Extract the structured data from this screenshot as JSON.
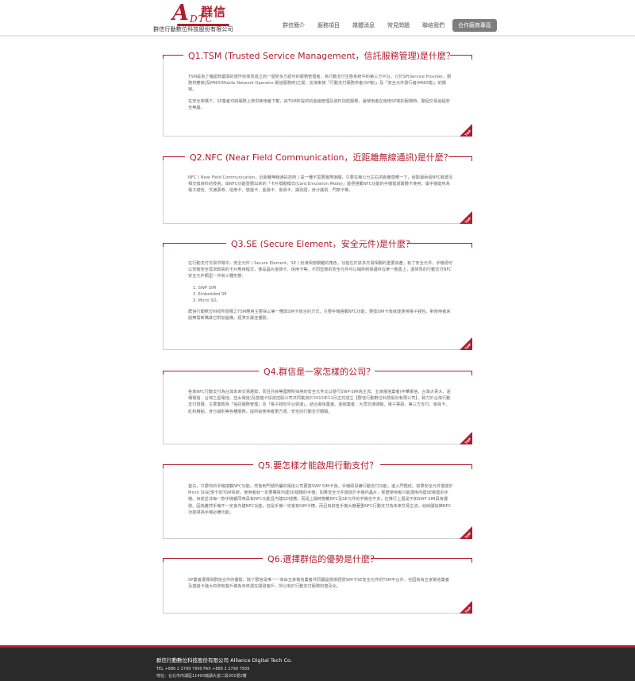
{
  "header": {
    "logo_letter": "A",
    "logo_sub": "DTC",
    "logo_zh": "群信",
    "company_name": "群信行動數位科技股份有限公司",
    "nav": [
      {
        "label": "群信簡介"
      },
      {
        "label": "服務項目"
      },
      {
        "label": "媒體消息"
      },
      {
        "label": "常見問題"
      },
      {
        "label": "聯絡我們"
      },
      {
        "label": "合作廠商專區"
      }
    ]
  },
  "faqs": [
    {
      "question": "Q1.TSM (Trusted Service Management，信託服務管理)是什麼？",
      "paragraphs": [
        "TSM是為了確認商業間的運作效率而成立的一個受多方認可的服務管理者，為行動支付生態系統中的第三方平台，介於SP(Service Provider，服務供應商)及MNO(Mobile Network Operator,電信服務商)之間，扮演串接「行動支付服務供者(SP端)」及「安全元件發行者(MNO端)」的橋樑。",
        "在安全架構下，SP業者可將服務上架供使用者下載，由TSM所提供的金鑰管理及資料加密服務，讓使用者在使用SP端的服務時，整個交易過程安全無虞。"
      ],
      "list": [],
      "top_label": "TOP"
    },
    {
      "question": "Q2.NFC (Near Field Communication，近距離無線通訊)是什麼？",
      "paragraphs": [
        "NFC ( Near Field Communication，近距離無線通訊技術 ) 是一種不需要實際接觸，只要在幾公分左右的距離感應一下，就能讓兩個NFC裝置互相交換資料的技術。由NFC功能發展出來的「卡片模擬模式(Card Emulation Mode)」能把搭載NFC功能的手機當成實體卡使用，讓手機變身為電子錢包、交通票券、信用卡、悠遊卡、金融卡、會員卡、識別證、身分識別、門禁卡等。"
      ],
      "list": [],
      "top_label": "TOP"
    },
    {
      "question": "Q3.SE (Secure Element，安全元件)是什麼？",
      "paragraphs": [
        "在行動支付交易市場中，安全元件 ( Secure Element，SE ) 扮演相當關鍵的角色，功能在於許多交易相關的重要資產，有了安全元件，手機便可以安裝安全需求較高的卡片應用程式，像是晶片金融卡、信用卡等。不同型態的安全元件可以儲存和保護存在單一裝置上，還常見的行動支付NFC安全元件類型一共有三種形態："
      ],
      "list": [
        "1. SWP SIM",
        "2. Embedded SE",
        "3. Micro SD。"
      ],
      "paragraphs_after": [
        "群信行動數位科技所發展之TSM應用主要採以第一種與SIM卡結合的方式，只要手機搭載NFC功能，更換SIM卡後就能使用電子錢包，對使用者來說無需新購其它附加設備，經濟又最佳優勢。"
      ],
      "top_label": "TOP"
    },
    {
      "question": "Q4.群信是一家怎樣的公司？",
      "paragraphs": [
        "各家NFC行動支付為台灣未來交易趨勢，而且外資等國際所採用的安全元件又以發行SWP-SIM為主流，五家電信業者(中華電信、台灣大哥大、遠傳電信、台灣之星電信、亞太電信)及悠遊卡投資控股公司共同集資於2013年11月正式成立【群信行動數位科技股份有限公司】，致力於台灣行動支付發展，主要業務為「信託服務管理」及「電子錢包平台營運」，結合電信業者、金融業者、大眾交通運輸、電子票證、第三方支付、會員卡、紅利積點、身分識別等各種服務，提供給使用者更方便、安全的行動支付體驗。"
      ],
      "list": [],
      "top_label": "TOP"
    },
    {
      "question": "Q5.要怎樣才能啟用行動支付？",
      "paragraphs": [
        "首先，只要你的手機搭載NFC功能，然後到門號所屬的電信公司更換SWP SIM卡後，手機即具備行動支付功能，進入門檻低。如果安全元件擺放於Micro SD記憶卡的TSM系統，使用者就一定要購買內建SD插槽的手機；如果安全元件擺放於手機內晶片，那麼使用者只能選用內建SE裝置的手機。目前並非每一款手機都同時具有NFC功能且內建SD插槽，而是上開時搭載NFC及SE元件的手機也不多，在推行上還是不如SWP SIM具有優勢。因為雖然手機不一定會內建NFC功能，但是手機一定會有SIM卡槽，而且目前各手機大廠著重NFC行動支付為未來交易主流，紛紛開始推NFC功能視為手機必備功能。"
      ],
      "list": [],
      "top_label": "TOP"
    },
    {
      "question": "Q6.選擇群信的優勢是什麼？",
      "paragraphs": [
        "SP業者選擇與群信合作的優勢，除了群信是唯一一家由五家電信業者共同籌設營運經營SIM卡SE安全元件的TSM平台外，也因為有五家電信業者及悠遊卡強大的既有客戶做為未來潛在開發客戶，所以有於行動支付服務的普及化。"
      ],
      "list": [],
      "top_label": "TOP"
    }
  ],
  "footer": {
    "company": "群信行動數位科技股份有限公司 Alliance Digital Tech Co.",
    "tel": "TEL +886 2 2799 7900  FAX +886 2 2799 7939",
    "address": "地址：台北市內湖區11493瑞湖大道二段301號2樓"
  }
}
